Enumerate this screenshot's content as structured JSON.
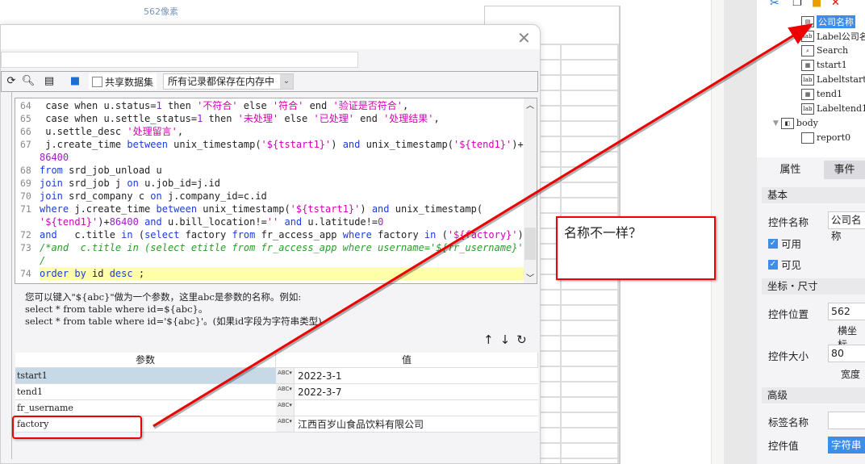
{
  "canvas": {
    "ruler_label": "562像素"
  },
  "dialog": {
    "close_icon": "close-icon",
    "toolbar": {
      "share_dataset_label": "共享数据集",
      "share_dataset_checked": false,
      "storage_mode": "所有记录都保存在内存中"
    },
    "code_lines": [
      {
        "no": "64",
        "tokens": [
          [
            "p",
            " case when u.status="
          ],
          [
            "n",
            "1"
          ],
          [
            "p",
            " then "
          ],
          [
            "s",
            "'不符合'"
          ],
          [
            "p",
            " else "
          ],
          [
            "s",
            "'符合'"
          ],
          [
            "p",
            " end "
          ],
          [
            "s",
            "'验证是否符合'"
          ],
          [
            "p",
            ","
          ]
        ]
      },
      {
        "no": "65",
        "tokens": [
          [
            "p",
            " case when u.settle_status="
          ],
          [
            "n",
            "1"
          ],
          [
            "p",
            " then "
          ],
          [
            "s",
            "'未处理'"
          ],
          [
            "p",
            " else "
          ],
          [
            "s",
            "'已处理'"
          ],
          [
            "p",
            " end "
          ],
          [
            "s",
            "'处理结果'"
          ],
          [
            "p",
            ","
          ]
        ]
      },
      {
        "no": "66",
        "tokens": [
          [
            "p",
            " u.settle_desc "
          ],
          [
            "s",
            "'处理留言'"
          ],
          [
            "p",
            ","
          ]
        ]
      },
      {
        "no": "67",
        "tokens": [
          [
            "p",
            " j.create_time "
          ],
          [
            "k",
            "between"
          ],
          [
            "p",
            " unix_timestamp("
          ],
          [
            "s",
            "'${tstart1}'"
          ],
          [
            "p",
            ") "
          ],
          [
            "k",
            "and"
          ],
          [
            "p",
            " unix_timestamp("
          ],
          [
            "s",
            "'${tend1}'"
          ],
          [
            "p",
            ")+"
          ]
        ]
      },
      {
        "no": "",
        "tokens": [
          [
            "n",
            "86400"
          ]
        ]
      },
      {
        "no": "68",
        "tokens": [
          [
            "k",
            "from"
          ],
          [
            "p",
            " srd_job_unload u"
          ]
        ]
      },
      {
        "no": "69",
        "tokens": [
          [
            "k",
            "join"
          ],
          [
            "p",
            " srd_job j "
          ],
          [
            "k",
            "on"
          ],
          [
            "p",
            " u.job_id=j.id"
          ]
        ]
      },
      {
        "no": "70",
        "tokens": [
          [
            "k",
            "join"
          ],
          [
            "p",
            " srd_company c "
          ],
          [
            "k",
            "on"
          ],
          [
            "p",
            " j.company_id=c.id"
          ]
        ]
      },
      {
        "no": "71",
        "tokens": [
          [
            "k",
            "where"
          ],
          [
            "p",
            " j.create_time "
          ],
          [
            "k",
            "between"
          ],
          [
            "p",
            " unix_timestamp("
          ],
          [
            "s",
            "'${tstart1}'"
          ],
          [
            "p",
            ") "
          ],
          [
            "k",
            "and"
          ],
          [
            "p",
            " unix_timestamp("
          ]
        ]
      },
      {
        "no": "",
        "tokens": [
          [
            "s",
            "'${tend1}'"
          ],
          [
            "p",
            ")+"
          ],
          [
            "n",
            "86400"
          ],
          [
            "p",
            " "
          ],
          [
            "k",
            "and"
          ],
          [
            "p",
            " u.bill_location!="
          ],
          [
            "s",
            "''"
          ],
          [
            "p",
            " "
          ],
          [
            "k",
            "and"
          ],
          [
            "p",
            " u.latitude!="
          ],
          [
            "n",
            "0"
          ]
        ]
      },
      {
        "no": "72",
        "tokens": [
          [
            "k",
            "and"
          ],
          [
            "p",
            "   c.title "
          ],
          [
            "k",
            "in"
          ],
          [
            "p",
            " ("
          ],
          [
            "k",
            "select"
          ],
          [
            "p",
            " factory "
          ],
          [
            "k",
            "from"
          ],
          [
            "p",
            " fr_access_app "
          ],
          [
            "k",
            "where"
          ],
          [
            "p",
            " factory "
          ],
          [
            "k",
            "in"
          ],
          [
            "p",
            " ("
          ],
          [
            "s",
            "'${factory}'"
          ],
          [
            "p",
            "))"
          ]
        ]
      },
      {
        "no": "73",
        "tokens": [
          [
            "c",
            "/*and  c.title in (select etitle from fr_access_app where username='${fr_username}')*"
          ]
        ]
      },
      {
        "no": "",
        "tokens": [
          [
            "c",
            "/"
          ]
        ]
      },
      {
        "no": "74",
        "current": true,
        "tokens": [
          [
            "k",
            "order by"
          ],
          [
            "p",
            " id "
          ],
          [
            "k",
            "desc"
          ],
          [
            "p",
            " ;"
          ]
        ]
      }
    ],
    "help_text": [
      "您可以键入\"${abc}\"做为一个参数，这里abc是参数的名称。例如:",
      "select * from table where id=${abc}。",
      "select * from table where id='${abc}'。(如果id字段为字符串类型)"
    ],
    "param_table": {
      "headers": [
        "参数",
        "值"
      ],
      "type_icon_text": "ABC",
      "rows": [
        {
          "name": "tstart1",
          "value": "2022-3-1",
          "selected": true
        },
        {
          "name": "tend1",
          "value": "2022-3-7"
        },
        {
          "name": "fr_username",
          "value": ""
        },
        {
          "name": "factory",
          "value": "江西百岁山食品饮料有限公司"
        }
      ]
    }
  },
  "annotation": {
    "text": "名称不一样？",
    "color": "#e00000"
  },
  "right_panel": {
    "tree": [
      {
        "label": "公司名称",
        "icon": "combo-box-icon",
        "selected": true
      },
      {
        "label": "Label公司名",
        "icon": "label-icon"
      },
      {
        "label": "Search",
        "icon": "search-doc-icon"
      },
      {
        "label": "tstart1",
        "icon": "calendar-icon"
      },
      {
        "label": "Labeltstart",
        "icon": "label-icon"
      },
      {
        "label": "tend1",
        "icon": "calendar-icon"
      },
      {
        "label": "Labeltend1",
        "icon": "label-icon"
      },
      {
        "label": "body",
        "icon": "body-icon",
        "expanded": true
      },
      {
        "label": "report0",
        "icon": "report-icon"
      }
    ],
    "tabs": [
      "属性",
      "事件"
    ],
    "sections": {
      "basic": "基本",
      "widget_name_label": "控件名称",
      "widget_name_value": "公司名称",
      "enabled_label": "可用",
      "enabled": true,
      "visible_label": "可见",
      "visible": true,
      "coords": "坐标・尺寸",
      "position_label": "控件位置",
      "position_value": "562",
      "position_sub": "横坐标",
      "size_label": "控件大小",
      "size_value": "80",
      "size_sub": "宽度",
      "advanced": "高级",
      "tag_name_label": "标签名称",
      "tag_name_value": "",
      "widget_value_label": "控件值",
      "widget_value_type": "字符串"
    }
  }
}
